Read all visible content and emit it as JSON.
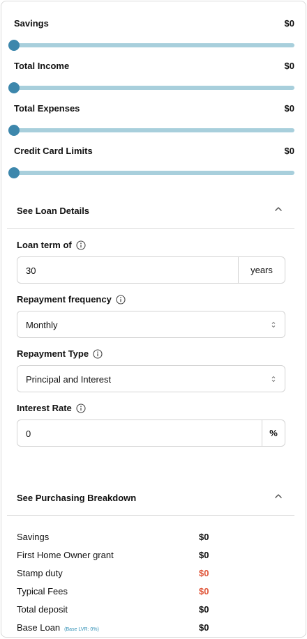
{
  "sliders": [
    {
      "label": "Savings",
      "value": "$0",
      "level": 0
    },
    {
      "label": "Total Income",
      "value": "$0",
      "level": 0
    },
    {
      "label": "Total Expenses",
      "value": "$0",
      "level": 0
    },
    {
      "label": "Credit Card Limits",
      "value": "$0",
      "level": 0
    }
  ],
  "loan_details": {
    "title": "See Loan Details",
    "loan_term": {
      "label": "Loan term of",
      "value": "30",
      "suffix": "years"
    },
    "repayment_frequency": {
      "label": "Repayment frequency",
      "value": "Monthly"
    },
    "repayment_type": {
      "label": "Repayment Type",
      "value": "Principal and Interest"
    },
    "interest_rate": {
      "label": "Interest Rate",
      "value": "0",
      "suffix": "%"
    }
  },
  "breakdown": {
    "title": "See Purchasing Breakdown",
    "rows": [
      {
        "label": "Savings",
        "amount": "$0"
      },
      {
        "label": "First Home Owner grant",
        "amount": "$0"
      },
      {
        "label": "Stamp duty",
        "amount": "$0"
      },
      {
        "label": "Typical Fees",
        "amount": "$0"
      },
      {
        "label": "Total deposit",
        "amount": "$0"
      },
      {
        "label": "Base Loan",
        "amount": "$0",
        "note": "(Base LVR: 0%)"
      }
    ]
  },
  "colors": {
    "accent": "#3d87ac",
    "track": "#a8cfdc",
    "negative": "#e0573a",
    "note": "#2f8fb5"
  }
}
